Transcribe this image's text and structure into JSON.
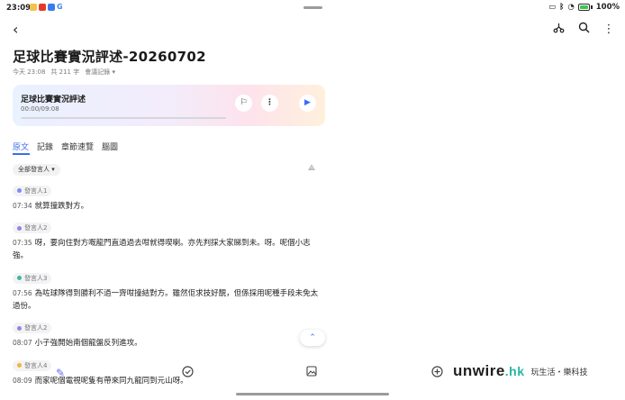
{
  "status": {
    "time": "23:09",
    "app_colors": [
      "#f2c14e",
      "#e13a2c",
      "#3c7af0"
    ],
    "app_last_label": "G",
    "battery_text": "100%"
  },
  "nav": {
    "back_icon": "back-arrow-icon",
    "share_icon": "share-icon",
    "search_icon": "search-icon",
    "more_icon": "more-vertical-icon"
  },
  "document": {
    "title": "足球比賽實況評述-20260702",
    "meta_time": "今天 23:08",
    "meta_count": "共 211 字",
    "meta_type": "會議記錄 ▾"
  },
  "player": {
    "title": "足球比賽實況評述",
    "time": "00:00/09:08",
    "progress": 0.0,
    "flag_icon": "flag-icon",
    "more_icon": "more-vertical-icon",
    "play_icon": "play-icon"
  },
  "tabs": [
    {
      "label": "原文",
      "active": true
    },
    {
      "label": "記錄",
      "active": false
    },
    {
      "label": "章節速覽",
      "active": false
    },
    {
      "label": "腦圖",
      "active": false
    }
  ],
  "filter": {
    "label": "全部發言人 ▾"
  },
  "transcript": [
    {
      "speaker": "發言人1",
      "color": "#7b8cf0",
      "time": "07:34",
      "text": "就算撞跌對方。"
    },
    {
      "speaker": "發言人2",
      "color": "#8f86e8",
      "time": "07:35",
      "text": "呀，要向住對方嘅龍門直過過去咁就得喫喇。亦先判採大家睇到未。呀。呢個小志強。"
    },
    {
      "speaker": "發言人3",
      "color": "#3fb8a0",
      "time": "07:56",
      "text": "為咗球隊得到勝利不過一齊咁撞結對方。雖然佢求技好靚，但係採用呢種手段未免太過份。"
    },
    {
      "speaker": "發言人2",
      "color": "#8f86e8",
      "time": "08:07",
      "text": "小子強開始南個龍盤反列進攻。"
    },
    {
      "speaker": "發言人4",
      "color": "#f0b43c",
      "time": "08:09",
      "text": "而家呢個電視呢隻有帶來同九龍同到元山呀。"
    }
  ],
  "bottom": {
    "ai_icon": "ai-pen-icon",
    "check_icon": "check-circle-icon",
    "image_icon": "image-icon",
    "add_icon": "add-circle-icon"
  },
  "watermark": {
    "brand": "unwire",
    "suffix": ".hk",
    "sub": "玩生活・樂科技"
  }
}
